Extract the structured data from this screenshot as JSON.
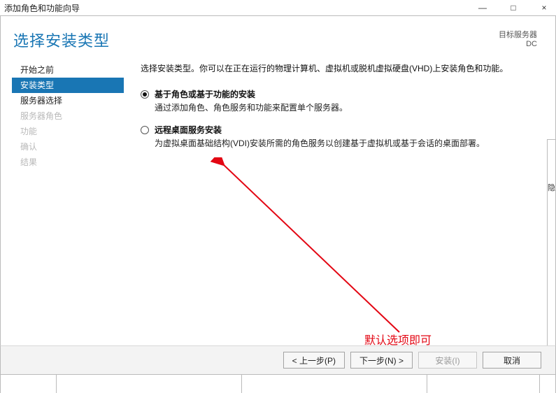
{
  "window": {
    "title": "添加角色和功能向导",
    "controls": {
      "min": "—",
      "max": "□",
      "close": "×"
    }
  },
  "header": {
    "page_title": "选择安装类型",
    "target_label": "目标服务器",
    "target_value": "DC"
  },
  "sidebar": {
    "items": [
      {
        "label": "开始之前",
        "state": "normal"
      },
      {
        "label": "安装类型",
        "state": "active"
      },
      {
        "label": "服务器选择",
        "state": "normal"
      },
      {
        "label": "服务器角色",
        "state": "disabled"
      },
      {
        "label": "功能",
        "state": "disabled"
      },
      {
        "label": "确认",
        "state": "disabled"
      },
      {
        "label": "结果",
        "state": "disabled"
      }
    ]
  },
  "main": {
    "intro": "选择安装类型。你可以在正在运行的物理计算机、虚拟机或脱机虚拟硬盘(VHD)上安装角色和功能。",
    "options": [
      {
        "title": "基于角色或基于功能的安装",
        "desc": "通过添加角色、角色服务和功能来配置单个服务器。",
        "selected": true
      },
      {
        "title": "远程桌面服务安装",
        "desc": "为虚拟桌面基础结构(VDI)安装所需的角色服务以创建基于虚拟机或基于会话的桌面部署。",
        "selected": false
      }
    ]
  },
  "annotation": {
    "text": "默认选项即可"
  },
  "gutter": {
    "char": "隐"
  },
  "footer": {
    "prev": "< 上一步(P)",
    "next": "下一步(N) >",
    "install": "安装(I)",
    "cancel": "取消"
  }
}
